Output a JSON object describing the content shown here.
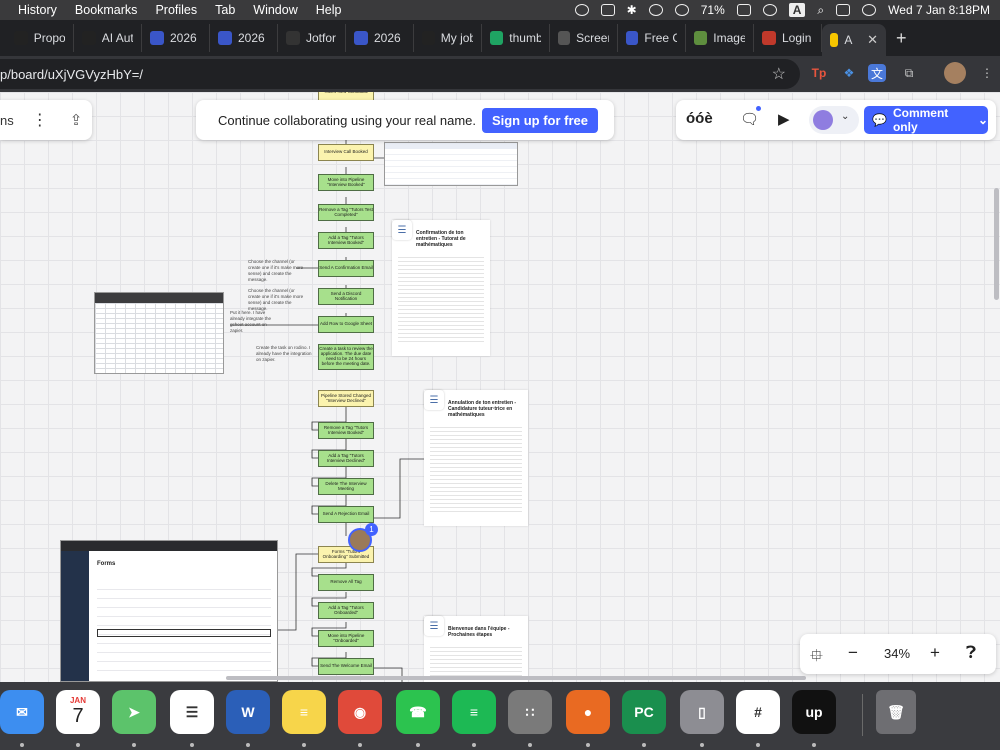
{
  "menubar": {
    "items": [
      "History",
      "Bookmarks",
      "Profiles",
      "Tab",
      "Window",
      "Help"
    ],
    "battery": "71%",
    "keyboard": "A",
    "datetime": "Wed 7 Jan  8:18PM"
  },
  "tabs": [
    {
      "label": "Propo",
      "icon": "upwork-icon",
      "color": "#222"
    },
    {
      "label": "AI Aut",
      "icon": "upwork-icon",
      "color": "#222"
    },
    {
      "label": "2026",
      "icon": "ghl-icon",
      "color": "#3a56c8"
    },
    {
      "label": "2026",
      "icon": "ghl-icon",
      "color": "#3a56c8"
    },
    {
      "label": "Jotfor",
      "icon": "jotform-icon",
      "color": "#333"
    },
    {
      "label": "2026",
      "icon": "ghl-icon",
      "color": "#3a56c8"
    },
    {
      "label": "My job",
      "icon": "upwork-icon",
      "color": "#222"
    },
    {
      "label": "thumb",
      "icon": "drive-icon",
      "color": "#1fa463"
    },
    {
      "label": "Screen",
      "icon": "globe-icon",
      "color": "#555"
    },
    {
      "label": "Free C",
      "icon": "ghl-icon",
      "color": "#3a56c8"
    },
    {
      "label": "Image",
      "icon": "shopify-icon",
      "color": "#5e8e3e"
    },
    {
      "label": "Login",
      "icon": "sandbox-icon",
      "color": "#c0392b"
    },
    {
      "label": "Au",
      "icon": "miro-icon",
      "color": "#f7c600",
      "active": true
    }
  ],
  "url": "p/board/uXjVGVyzHbY=/",
  "topleft": {
    "label": "ns"
  },
  "banner": {
    "message": "Continue collaborating using your real name.",
    "signup": "Sign up for free"
  },
  "rightpanel": {
    "reactions": "óóè",
    "comment_only": "Comment only"
  },
  "zoom": {
    "value": "34%"
  },
  "presence": {
    "count": "1"
  },
  "flow1": [
    {
      "text": "\"Tutors New Candidate\"",
      "color": "yellow"
    },
    {
      "text": "Interview Call Booked",
      "color": "yellow"
    },
    {
      "text": "Move into Pipeline \"Interview Booked\"",
      "color": "green"
    },
    {
      "text": "Remove a Tag \"Tutors Test Completed\"",
      "color": "green"
    },
    {
      "text": "Add a Tag \"Tutors Interview Booked\"",
      "color": "green"
    },
    {
      "text": "Send A Confirmation Email",
      "color": "green"
    },
    {
      "text": "Send a Discord Notification",
      "color": "green"
    },
    {
      "text": "Add Row to Google Sheet",
      "color": "green"
    },
    {
      "text": "Create a task to review the application. The due date need to be 24 hours before the meeting date.",
      "color": "green"
    }
  ],
  "flow2": [
    {
      "text": "Pipeline Stored Changed \"Interview Declined\"",
      "color": "yellow"
    },
    {
      "text": "Remove a Tag \"Tutors Interview Booked\"",
      "color": "green"
    },
    {
      "text": "Add a Tag \"Tutors Interview Declined\"",
      "color": "green"
    },
    {
      "text": "Delete The Interview Meeting",
      "color": "green"
    },
    {
      "text": "Send A Rejection Email",
      "color": "green"
    }
  ],
  "flow3": [
    {
      "text": "Forms \"Tutors Onboarding\" Submitted",
      "color": "yellow"
    },
    {
      "text": "Remove All Tag",
      "color": "green"
    },
    {
      "text": "Add a Tag \"Tutors Onboarded\"",
      "color": "green"
    },
    {
      "text": "Move into Pipeline \"Onboarded\"",
      "color": "green"
    },
    {
      "text": "Send The Welcome Email",
      "color": "green"
    }
  ],
  "notes": [
    "Choose the channel (or create one if it's make more sense) and create the message.",
    "Choose the channel (or create one if it's make more sense) and create the message.",
    "Put it here. I have already integrate the gsheet account on zapier.",
    "Create the task on rodino. I already have the integration on zapier."
  ],
  "docs": [
    {
      "title": "Confirmation de ton entretien - Tutorat de mathématiques"
    },
    {
      "title": "Annulation de ton entretien - Candidature tuteur·trice en mathématiques"
    },
    {
      "title": "Bienvenue dans l'équipe - Prochaines étapes"
    }
  ],
  "embedded_form": {
    "title": "Forms"
  },
  "dock": [
    {
      "name": "mail-icon",
      "color": "#3d8ef0",
      "glyph": "✉"
    },
    {
      "name": "calendar-icon",
      "color": "#ffffff",
      "glyph": "7"
    },
    {
      "name": "maps-icon",
      "color": "#5cc36b",
      "glyph": "➤"
    },
    {
      "name": "reminders-icon",
      "color": "#ffffff",
      "glyph": "☰"
    },
    {
      "name": "word-icon",
      "color": "#2b5fb8",
      "glyph": "W"
    },
    {
      "name": "notes-icon",
      "color": "#f7d54a",
      "glyph": "≡"
    },
    {
      "name": "chrome-icon",
      "color": "#e04a3a",
      "glyph": "◉"
    },
    {
      "name": "whatsapp-icon",
      "color": "#2cc34f",
      "glyph": "☎"
    },
    {
      "name": "spotify-icon",
      "color": "#1db954",
      "glyph": "≡"
    },
    {
      "name": "calculator-icon",
      "color": "#7a7a7a",
      "glyph": "∷"
    },
    {
      "name": "firefox-icon",
      "color": "#e96a22",
      "glyph": "●"
    },
    {
      "name": "pycharm-icon",
      "color": "#1a8f4e",
      "glyph": "PC"
    },
    {
      "name": "iphone-mirroring-icon",
      "color": "#8d8d93",
      "glyph": "▯"
    },
    {
      "name": "slack-icon",
      "color": "#ffffff",
      "glyph": "#"
    },
    {
      "name": "upwork-icon",
      "color": "#111111",
      "glyph": "up"
    }
  ],
  "calendar": {
    "month": "JAN",
    "day": "7"
  }
}
